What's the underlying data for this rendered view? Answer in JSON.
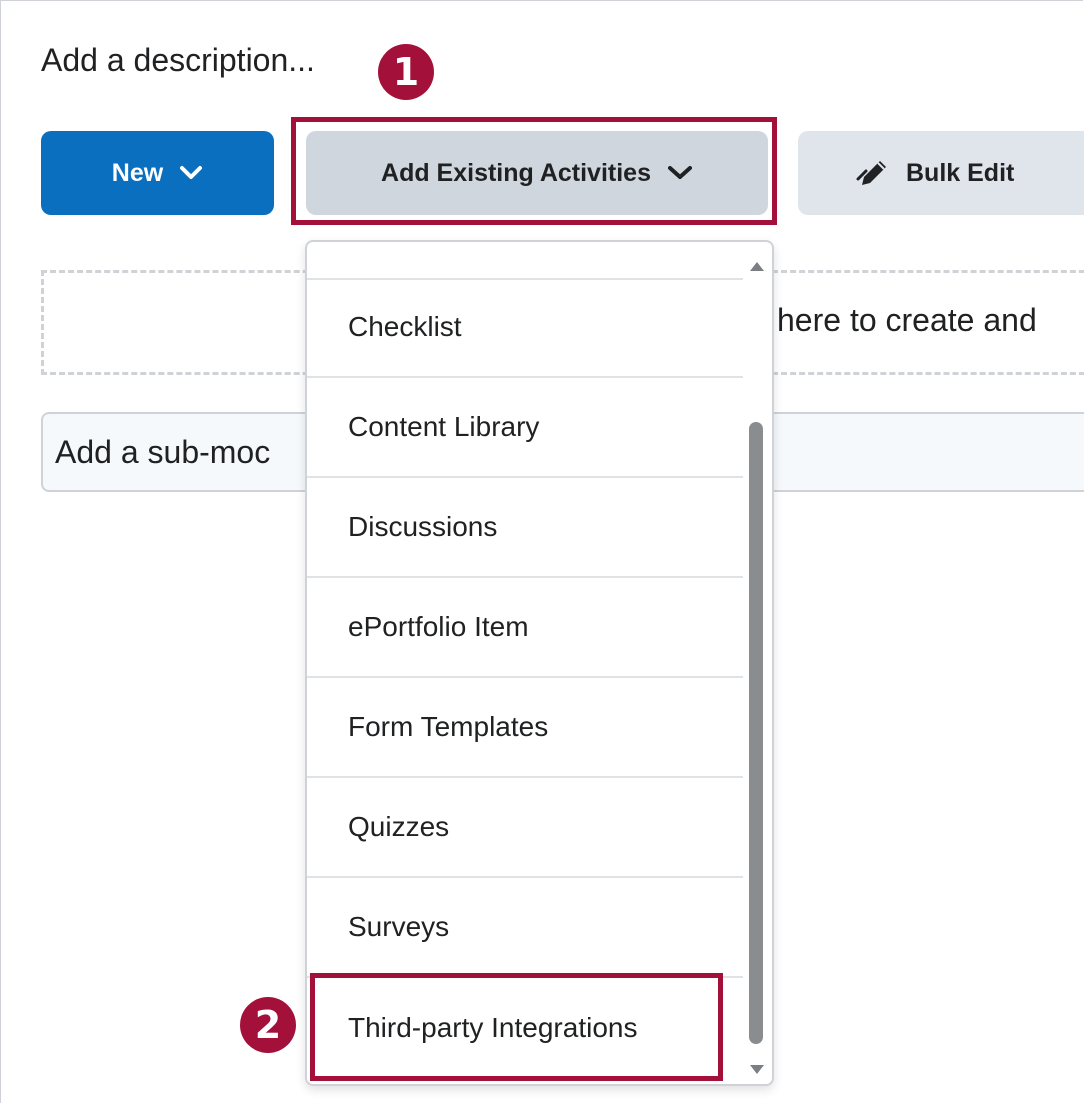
{
  "description_placeholder": "Add a description...",
  "callouts": {
    "step1": "1",
    "step2": "2"
  },
  "toolbar": {
    "new_label": "New",
    "add_existing_label": "Add Existing Activities",
    "bulk_edit_label": "Bulk Edit"
  },
  "drop_zone_text": "here to create and",
  "submodule_placeholder": "Add a sub-moc",
  "menu_items": [
    "Checklist",
    "Content Library",
    "Discussions",
    "ePortfolio Item",
    "Form Templates",
    "Quizzes",
    "Surveys",
    "Third-party Integrations"
  ],
  "icons": {
    "new_chevron": "chevron-down-icon",
    "add_chevron": "chevron-down-icon",
    "bulk_edit": "pencil-edit-icon",
    "scroll_up": "scroll-up-arrow-icon",
    "scroll_down": "scroll-down-arrow-icon"
  },
  "colors": {
    "primary": "#0a6fbf",
    "highlight": "#a3113a",
    "secondary_button": "#cfd6de"
  }
}
